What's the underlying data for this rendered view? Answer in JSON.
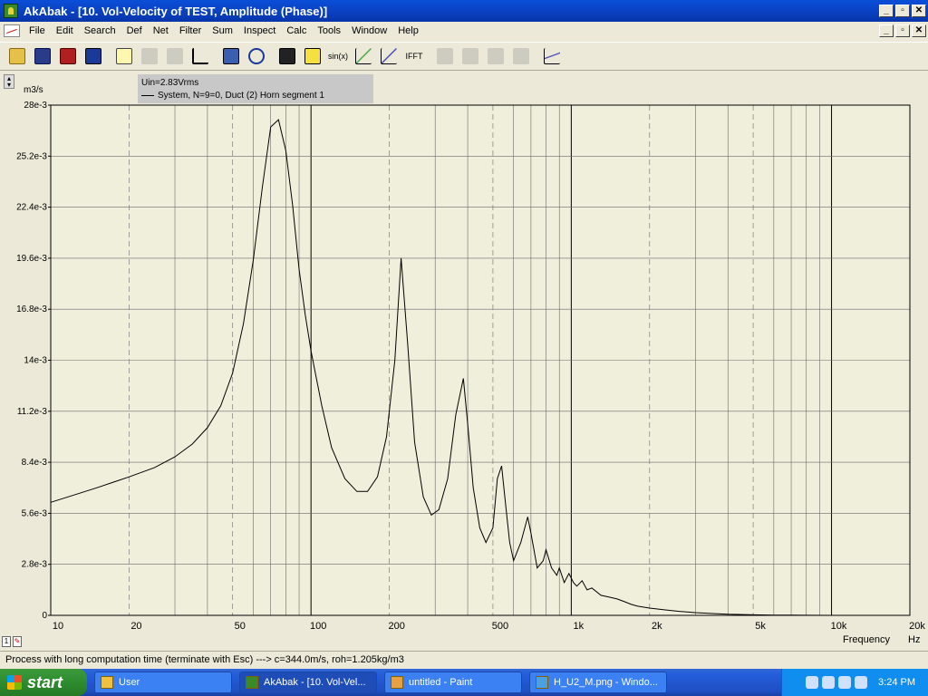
{
  "window": {
    "title": "AkAbak - [10. Vol-Velocity of TEST, Amplitude (Phase)]"
  },
  "menus": [
    "File",
    "Edit",
    "Search",
    "Def",
    "Net",
    "Filter",
    "Sum",
    "Inspect",
    "Calc",
    "Tools",
    "Window",
    "Help"
  ],
  "toolbar": {
    "sin_label": "sin(x)",
    "ifft_label": "IFFT"
  },
  "legend": {
    "line1": "Uin=2.83Vrms",
    "line2": "System, N=9=0, Duct (2) Horn segment 1"
  },
  "chart_data": {
    "type": "line",
    "ylabel": "m3/s",
    "xlabel": "Frequency",
    "xunit": "Hz",
    "xscale": "log",
    "xlim": [
      10,
      20000
    ],
    "ylim": [
      0,
      0.028
    ],
    "xticks": [
      {
        "value": 10,
        "label": "10"
      },
      {
        "value": 20,
        "label": "20"
      },
      {
        "value": 50,
        "label": "50"
      },
      {
        "value": 100,
        "label": "100"
      },
      {
        "value": 200,
        "label": "200"
      },
      {
        "value": 500,
        "label": "500"
      },
      {
        "value": 1000,
        "label": "1k"
      },
      {
        "value": 2000,
        "label": "2k"
      },
      {
        "value": 5000,
        "label": "5k"
      },
      {
        "value": 10000,
        "label": "10k"
      },
      {
        "value": 20000,
        "label": "20k"
      }
    ],
    "yticks": [
      {
        "value": 0,
        "label": "0"
      },
      {
        "value": 0.0028,
        "label": "2.8e-3"
      },
      {
        "value": 0.0056,
        "label": "5.6e-3"
      },
      {
        "value": 0.0084,
        "label": "8.4e-3"
      },
      {
        "value": 0.0112,
        "label": "11.2e-3"
      },
      {
        "value": 0.014,
        "label": "14e-3"
      },
      {
        "value": 0.0168,
        "label": "16.8e-3"
      },
      {
        "value": 0.0196,
        "label": "19.6e-3"
      },
      {
        "value": 0.0224,
        "label": "22.4e-3"
      },
      {
        "value": 0.0252,
        "label": "25.2e-3"
      },
      {
        "value": 0.028,
        "label": "28e-3"
      }
    ],
    "grid": true,
    "series": [
      {
        "name": "System, N=9=0, Duct (2) Horn segment 1",
        "color": "#000000",
        "x": [
          10,
          15,
          20,
          25,
          30,
          35,
          40,
          45,
          50,
          55,
          60,
          65,
          70,
          75,
          80,
          85,
          90,
          95,
          100,
          110,
          120,
          135,
          150,
          165,
          180,
          195,
          210,
          222,
          235,
          250,
          270,
          290,
          310,
          335,
          360,
          385,
          400,
          420,
          445,
          470,
          500,
          520,
          540,
          560,
          580,
          600,
          640,
          680,
          700,
          740,
          780,
          800,
          840,
          880,
          900,
          940,
          980,
          1020,
          1050,
          1100,
          1150,
          1200,
          1300,
          1400,
          1500,
          1600,
          1700,
          1800,
          2000,
          2300,
          2600,
          3000,
          3500,
          4000,
          5000,
          6000,
          7000,
          8000,
          10000
        ],
        "y": [
          0.0062,
          0.007,
          0.0076,
          0.0081,
          0.0087,
          0.0094,
          0.0103,
          0.0115,
          0.0133,
          0.016,
          0.0195,
          0.0235,
          0.0268,
          0.0272,
          0.0255,
          0.0225,
          0.019,
          0.0165,
          0.0145,
          0.0115,
          0.0092,
          0.0075,
          0.0068,
          0.0068,
          0.0076,
          0.0098,
          0.014,
          0.0196,
          0.015,
          0.0095,
          0.0065,
          0.0055,
          0.0058,
          0.0075,
          0.011,
          0.013,
          0.0105,
          0.007,
          0.0048,
          0.004,
          0.0048,
          0.0075,
          0.0082,
          0.006,
          0.004,
          0.003,
          0.004,
          0.0054,
          0.0045,
          0.0026,
          0.003,
          0.0036,
          0.0026,
          0.0022,
          0.0026,
          0.0018,
          0.0023,
          0.0018,
          0.0016,
          0.0019,
          0.0014,
          0.0015,
          0.0011,
          0.001,
          0.0009,
          0.00075,
          0.0006,
          0.0005,
          0.0004,
          0.0003,
          0.00022,
          0.00015,
          0.0001,
          6e-05,
          3e-05,
          1.5e-05,
          8e-06,
          4e-06,
          1e-06
        ]
      }
    ]
  },
  "statusbar": {
    "text": "Process with long computation time (terminate with Esc) ---> c=344.0m/s, roh=1.205kg/m3"
  },
  "taskbar": {
    "start_label": "start",
    "tasks": [
      "User",
      "AkAbak - [10. Vol-Vel...",
      "untitled - Paint",
      "H_U2_M.png - Windo..."
    ],
    "clock": "3:24 PM"
  }
}
